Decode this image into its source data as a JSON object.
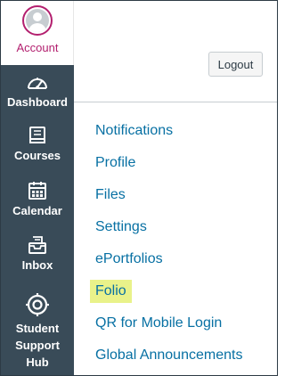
{
  "account": {
    "label": "Account"
  },
  "global_nav": {
    "items": [
      {
        "label": "Dashboard",
        "icon": "dashboard-icon"
      },
      {
        "label": "Courses",
        "icon": "courses-icon"
      },
      {
        "label": "Calendar",
        "icon": "calendar-icon"
      },
      {
        "label": "Inbox",
        "icon": "inbox-icon"
      },
      {
        "label_lines": [
          "Student",
          "Support",
          "Hub"
        ],
        "icon": "help-icon"
      }
    ]
  },
  "tray": {
    "logout_label": "Logout",
    "links": [
      {
        "label": "Notifications"
      },
      {
        "label": "Profile"
      },
      {
        "label": "Files"
      },
      {
        "label": "Settings"
      },
      {
        "label": "ePortfolios"
      },
      {
        "label": "Folio",
        "highlighted": true
      },
      {
        "label": "QR for Mobile Login"
      },
      {
        "label": "Global Announcements"
      }
    ]
  },
  "colors": {
    "nav_bg": "#394b58",
    "account_accent": "#b3206f",
    "link": "#0770a3",
    "highlight": "#e9f28a"
  }
}
